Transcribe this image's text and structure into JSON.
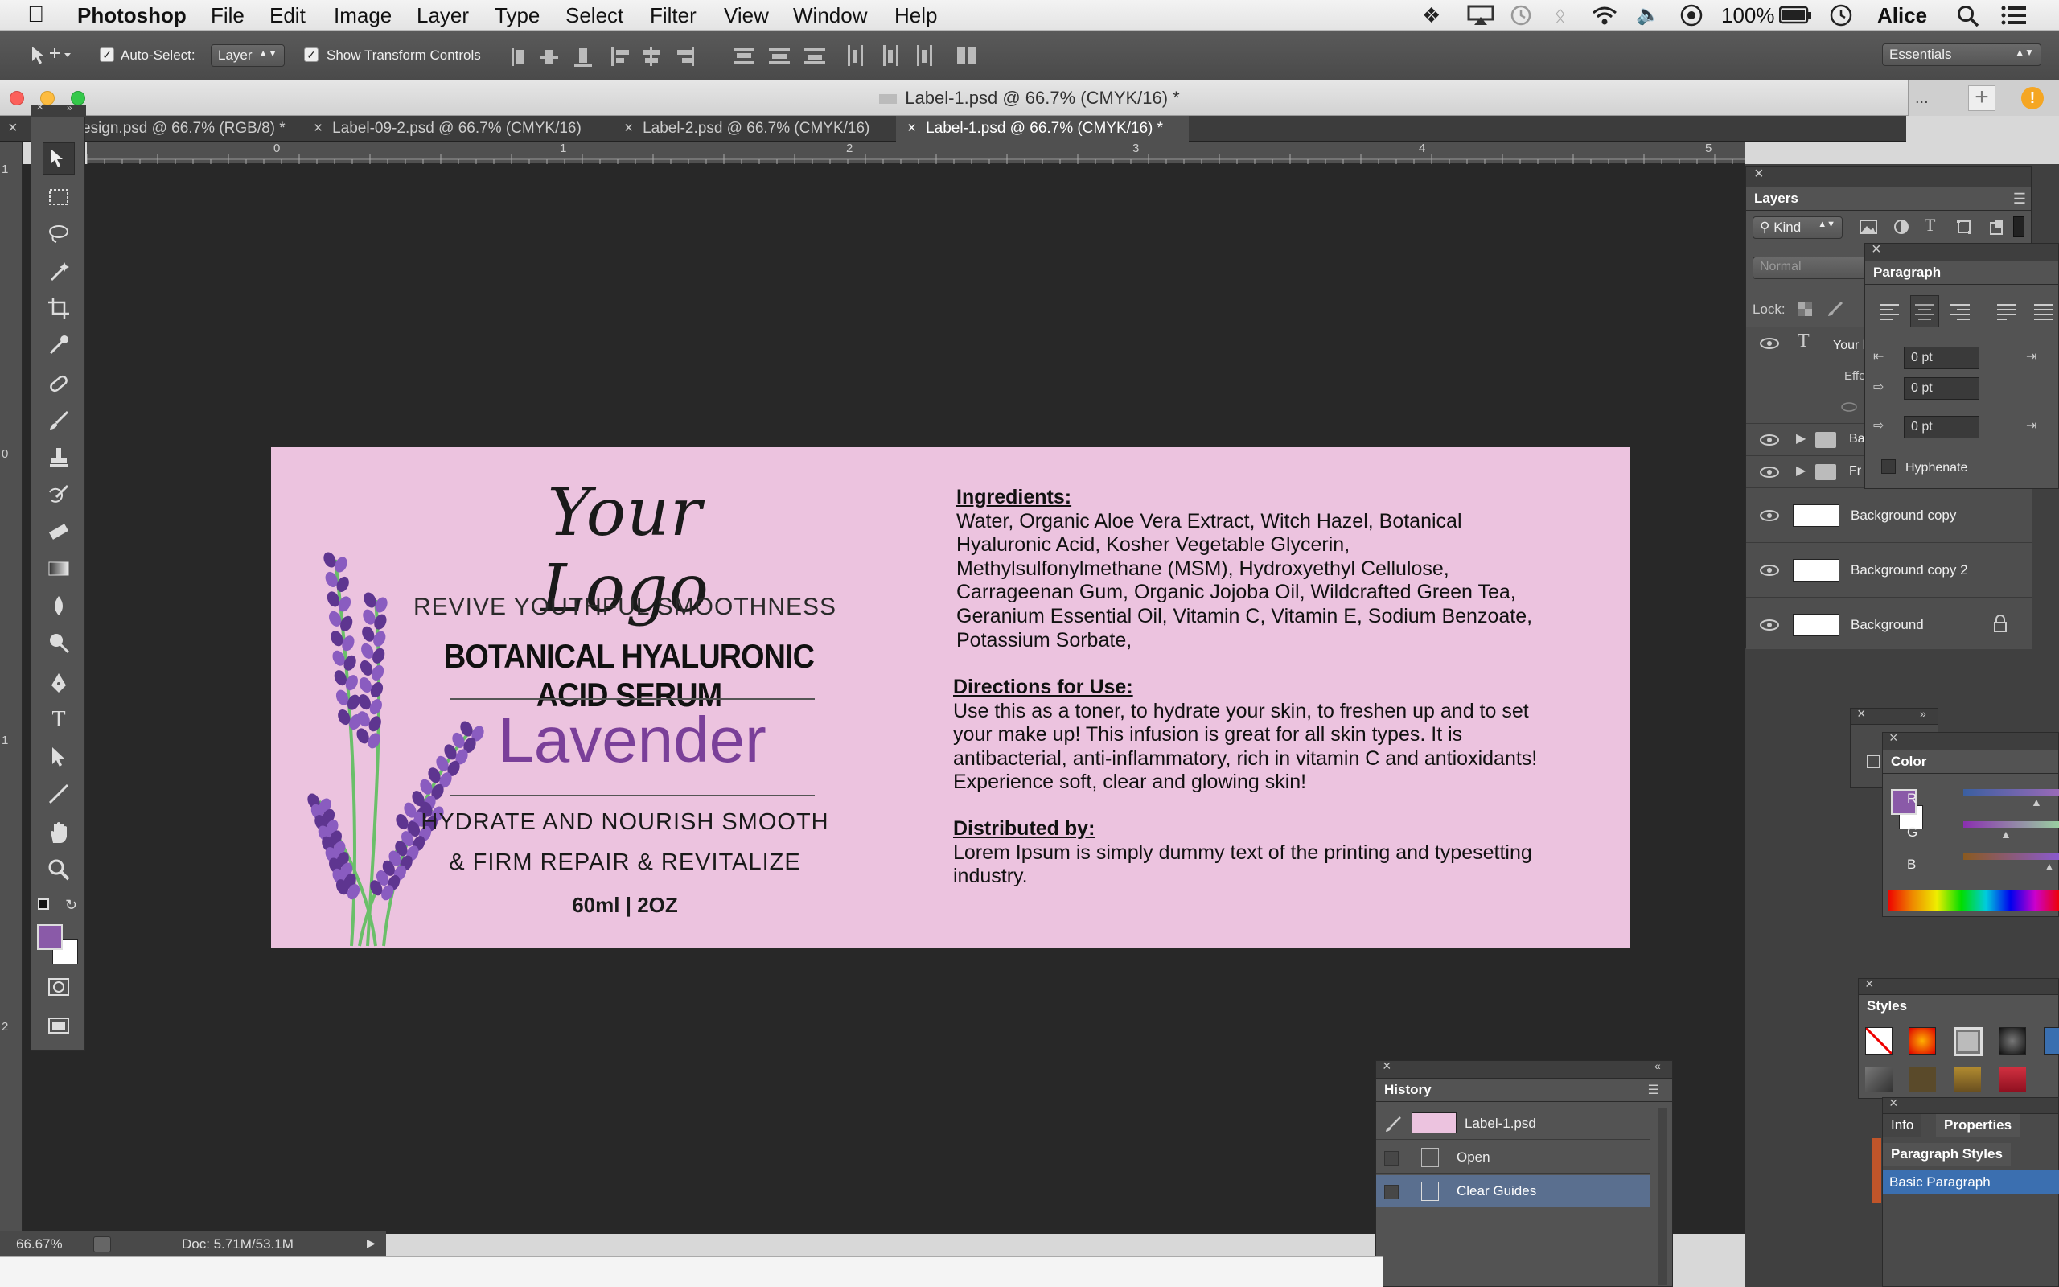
{
  "menubar": {
    "app_name": "Photoshop",
    "menus": [
      "File",
      "Edit",
      "Image",
      "Layer",
      "Type",
      "Select",
      "Filter",
      "View",
      "Window",
      "Help"
    ],
    "battery": "100%",
    "user": "Alice"
  },
  "options": {
    "auto_select_label": "Auto-Select:",
    "auto_select_value": "Layer",
    "show_transform_label": "Show Transform Controls",
    "workspace_value": "Essentials"
  },
  "window": {
    "title": "Label-1.psd @ 66.7% (CMYK/16) *"
  },
  "tabs": [
    {
      "label": "esign.psd @ 66.7% (RGB/8) *"
    },
    {
      "label": "Label-09-2.psd @ 66.7% (CMYK/16)"
    },
    {
      "label": "Label-2.psd @ 66.7% (CMYK/16)"
    },
    {
      "label": "Label-1.psd @ 66.7% (CMYK/16) *"
    }
  ],
  "rulers": {
    "top_ticks": [
      "0",
      "1",
      "2",
      "3",
      "4",
      "5"
    ],
    "left_ticks": [
      "1",
      "0",
      "1",
      "2"
    ]
  },
  "label": {
    "logo": "Your Logo",
    "tagline": "REVIVE YOUTHFUL SMOOTHNESS",
    "product": "BOTANICAL HYALURONIC ACID SERUM",
    "variant": "Lavender",
    "benefit1": "HYDRATE AND NOURISH SMOOTH",
    "benefit2": "& FIRM REPAIR & REVITALIZE",
    "size": "60ml | 2OZ",
    "ingredients_heading": "Ingredients:",
    "ingredients_lines": [
      "Water, Organic Aloe Vera Extract, Witch Hazel, Botanical",
      "Hyaluronic Acid, Kosher Vegetable Glycerin,",
      "Methylsulfonylmethane (MSM), Hydroxyethyl Cellulose,",
      "Carrageenan Gum, Organic Jojoba Oil, Wildcrafted Green Tea,",
      "Geranium Essential Oil, Vitamin C, Vitamin E, Sodium Benzoate,",
      "Potassium Sorbate,"
    ],
    "directions_heading": "Directions for Use:",
    "directions_lines": [
      "Use this as a toner, to hydrate your skin, to freshen up and to set",
      "your make up! This infusion is great for all skin types. It is",
      "antibacterial, anti-inflammatory, rich in vitamin C and antioxidants!",
      "Experience soft, clear and glowing skin!"
    ],
    "distributed_heading": "Distributed by:",
    "distributed_lines": [
      "Lorem Ipsum is simply dummy text of the printing and typesetting",
      "industry."
    ]
  },
  "layers_panel": {
    "tab": "Layers",
    "filter": "Kind",
    "blend_mode": "Normal",
    "lock_label": "Lock:",
    "layers": [
      {
        "name": "Your l",
        "sub": "Effe"
      },
      {
        "name": "Ba"
      },
      {
        "name": "Fr"
      },
      {
        "name": "Background copy"
      },
      {
        "name": "Background copy 2"
      },
      {
        "name": "Background"
      }
    ]
  },
  "paragraph_panel": {
    "tab": "Paragraph",
    "indent_left": "0 pt",
    "indent_first": "0 pt",
    "space_before": "0 pt",
    "hyphenate_label": "Hyphenate"
  },
  "color_panel": {
    "tab": "Color",
    "channels": [
      "R",
      "G",
      "B"
    ],
    "foreground": "#8a5aa8"
  },
  "styles_panel": {
    "tab": "Styles"
  },
  "info_panel": {
    "tabs": [
      "Info",
      "Properties"
    ],
    "sub_tab": "Paragraph Styles",
    "style_item": "Basic Paragraph"
  },
  "history_panel": {
    "tab": "History",
    "snapshot": "Label-1.psd",
    "items": [
      "Open",
      "Clear Guides"
    ]
  },
  "status": {
    "zoom": "66.67%",
    "doc": "Doc: 5.71M/53.1M"
  },
  "colors": {
    "label_bg": "#ecc3df",
    "lavender": "#7a3f99",
    "accent": "#3b6fb0"
  }
}
